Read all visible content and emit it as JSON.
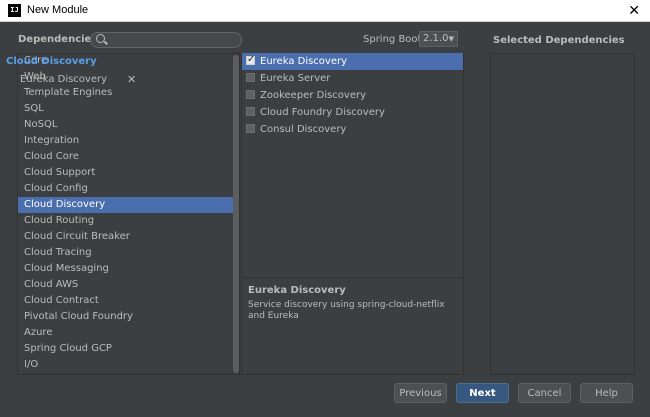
{
  "window": {
    "title": "New Module",
    "app_icon_text": "IJ",
    "close_icon": "close-icon"
  },
  "header": {
    "dependencies_label": "Dependencies",
    "search": {
      "placeholder": "",
      "value": ""
    },
    "spring_boot_label": "Spring Boot",
    "spring_boot_version": "2.1.0",
    "selected_label": "Selected Dependencies"
  },
  "categories": [
    {
      "label": "Core",
      "selected": false
    },
    {
      "label": "Web",
      "selected": false
    },
    {
      "label": "Template Engines",
      "selected": false
    },
    {
      "label": "SQL",
      "selected": false
    },
    {
      "label": "NoSQL",
      "selected": false
    },
    {
      "label": "Integration",
      "selected": false
    },
    {
      "label": "Cloud Core",
      "selected": false
    },
    {
      "label": "Cloud Support",
      "selected": false
    },
    {
      "label": "Cloud Config",
      "selected": false
    },
    {
      "label": "Cloud Discovery",
      "selected": true
    },
    {
      "label": "Cloud Routing",
      "selected": false
    },
    {
      "label": "Cloud Circuit Breaker",
      "selected": false
    },
    {
      "label": "Cloud Tracing",
      "selected": false
    },
    {
      "label": "Cloud Messaging",
      "selected": false
    },
    {
      "label": "Cloud AWS",
      "selected": false
    },
    {
      "label": "Cloud Contract",
      "selected": false
    },
    {
      "label": "Pivotal Cloud Foundry",
      "selected": false
    },
    {
      "label": "Azure",
      "selected": false
    },
    {
      "label": "Spring Cloud GCP",
      "selected": false
    },
    {
      "label": "I/O",
      "selected": false
    }
  ],
  "dependencies": [
    {
      "label": "Eureka Discovery",
      "checked": true,
      "selected": true
    },
    {
      "label": "Eureka Server",
      "checked": false,
      "selected": false
    },
    {
      "label": "Zookeeper Discovery",
      "checked": false,
      "selected": false
    },
    {
      "label": "Cloud Foundry Discovery",
      "checked": false,
      "selected": false
    },
    {
      "label": "Consul Discovery",
      "checked": false,
      "selected": false
    }
  ],
  "description": {
    "title": "Eureka Discovery",
    "text": "Service discovery using spring-cloud-netflix and Eureka"
  },
  "selected": {
    "group": "Cloud Discovery",
    "items": [
      {
        "label": "Eureka Discovery",
        "remove_icon": "✕"
      }
    ]
  },
  "buttons": {
    "previous": "Previous",
    "next": "Next",
    "cancel": "Cancel",
    "help": "Help"
  },
  "colors": {
    "background": "#3c3f41",
    "selection": "#4b6eaf",
    "group_header": "#5a9ee8",
    "primary_button": "#365880"
  }
}
